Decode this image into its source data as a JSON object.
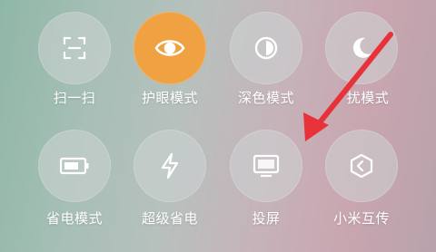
{
  "control_center": {
    "row1": [
      {
        "label": "扫一扫",
        "icon": "scan-icon",
        "active": false
      },
      {
        "label": "护眼模式",
        "icon": "eye-icon",
        "active": true
      },
      {
        "label": "深色模式",
        "icon": "contrast-icon",
        "active": false
      },
      {
        "label": "扰模式",
        "icon": "moon-icon",
        "active": false
      }
    ],
    "row2": [
      {
        "label": "省电模式",
        "icon": "battery-icon",
        "active": false
      },
      {
        "label": "超级省电",
        "icon": "lightning-icon",
        "active": false
      },
      {
        "label": "投屏",
        "icon": "screen-cast-icon",
        "active": false
      },
      {
        "label": "小米互传",
        "icon": "mi-share-icon",
        "active": false
      }
    ]
  },
  "colors": {
    "active_tile": "#f0a141",
    "annotation_arrow": "#e8323a"
  }
}
